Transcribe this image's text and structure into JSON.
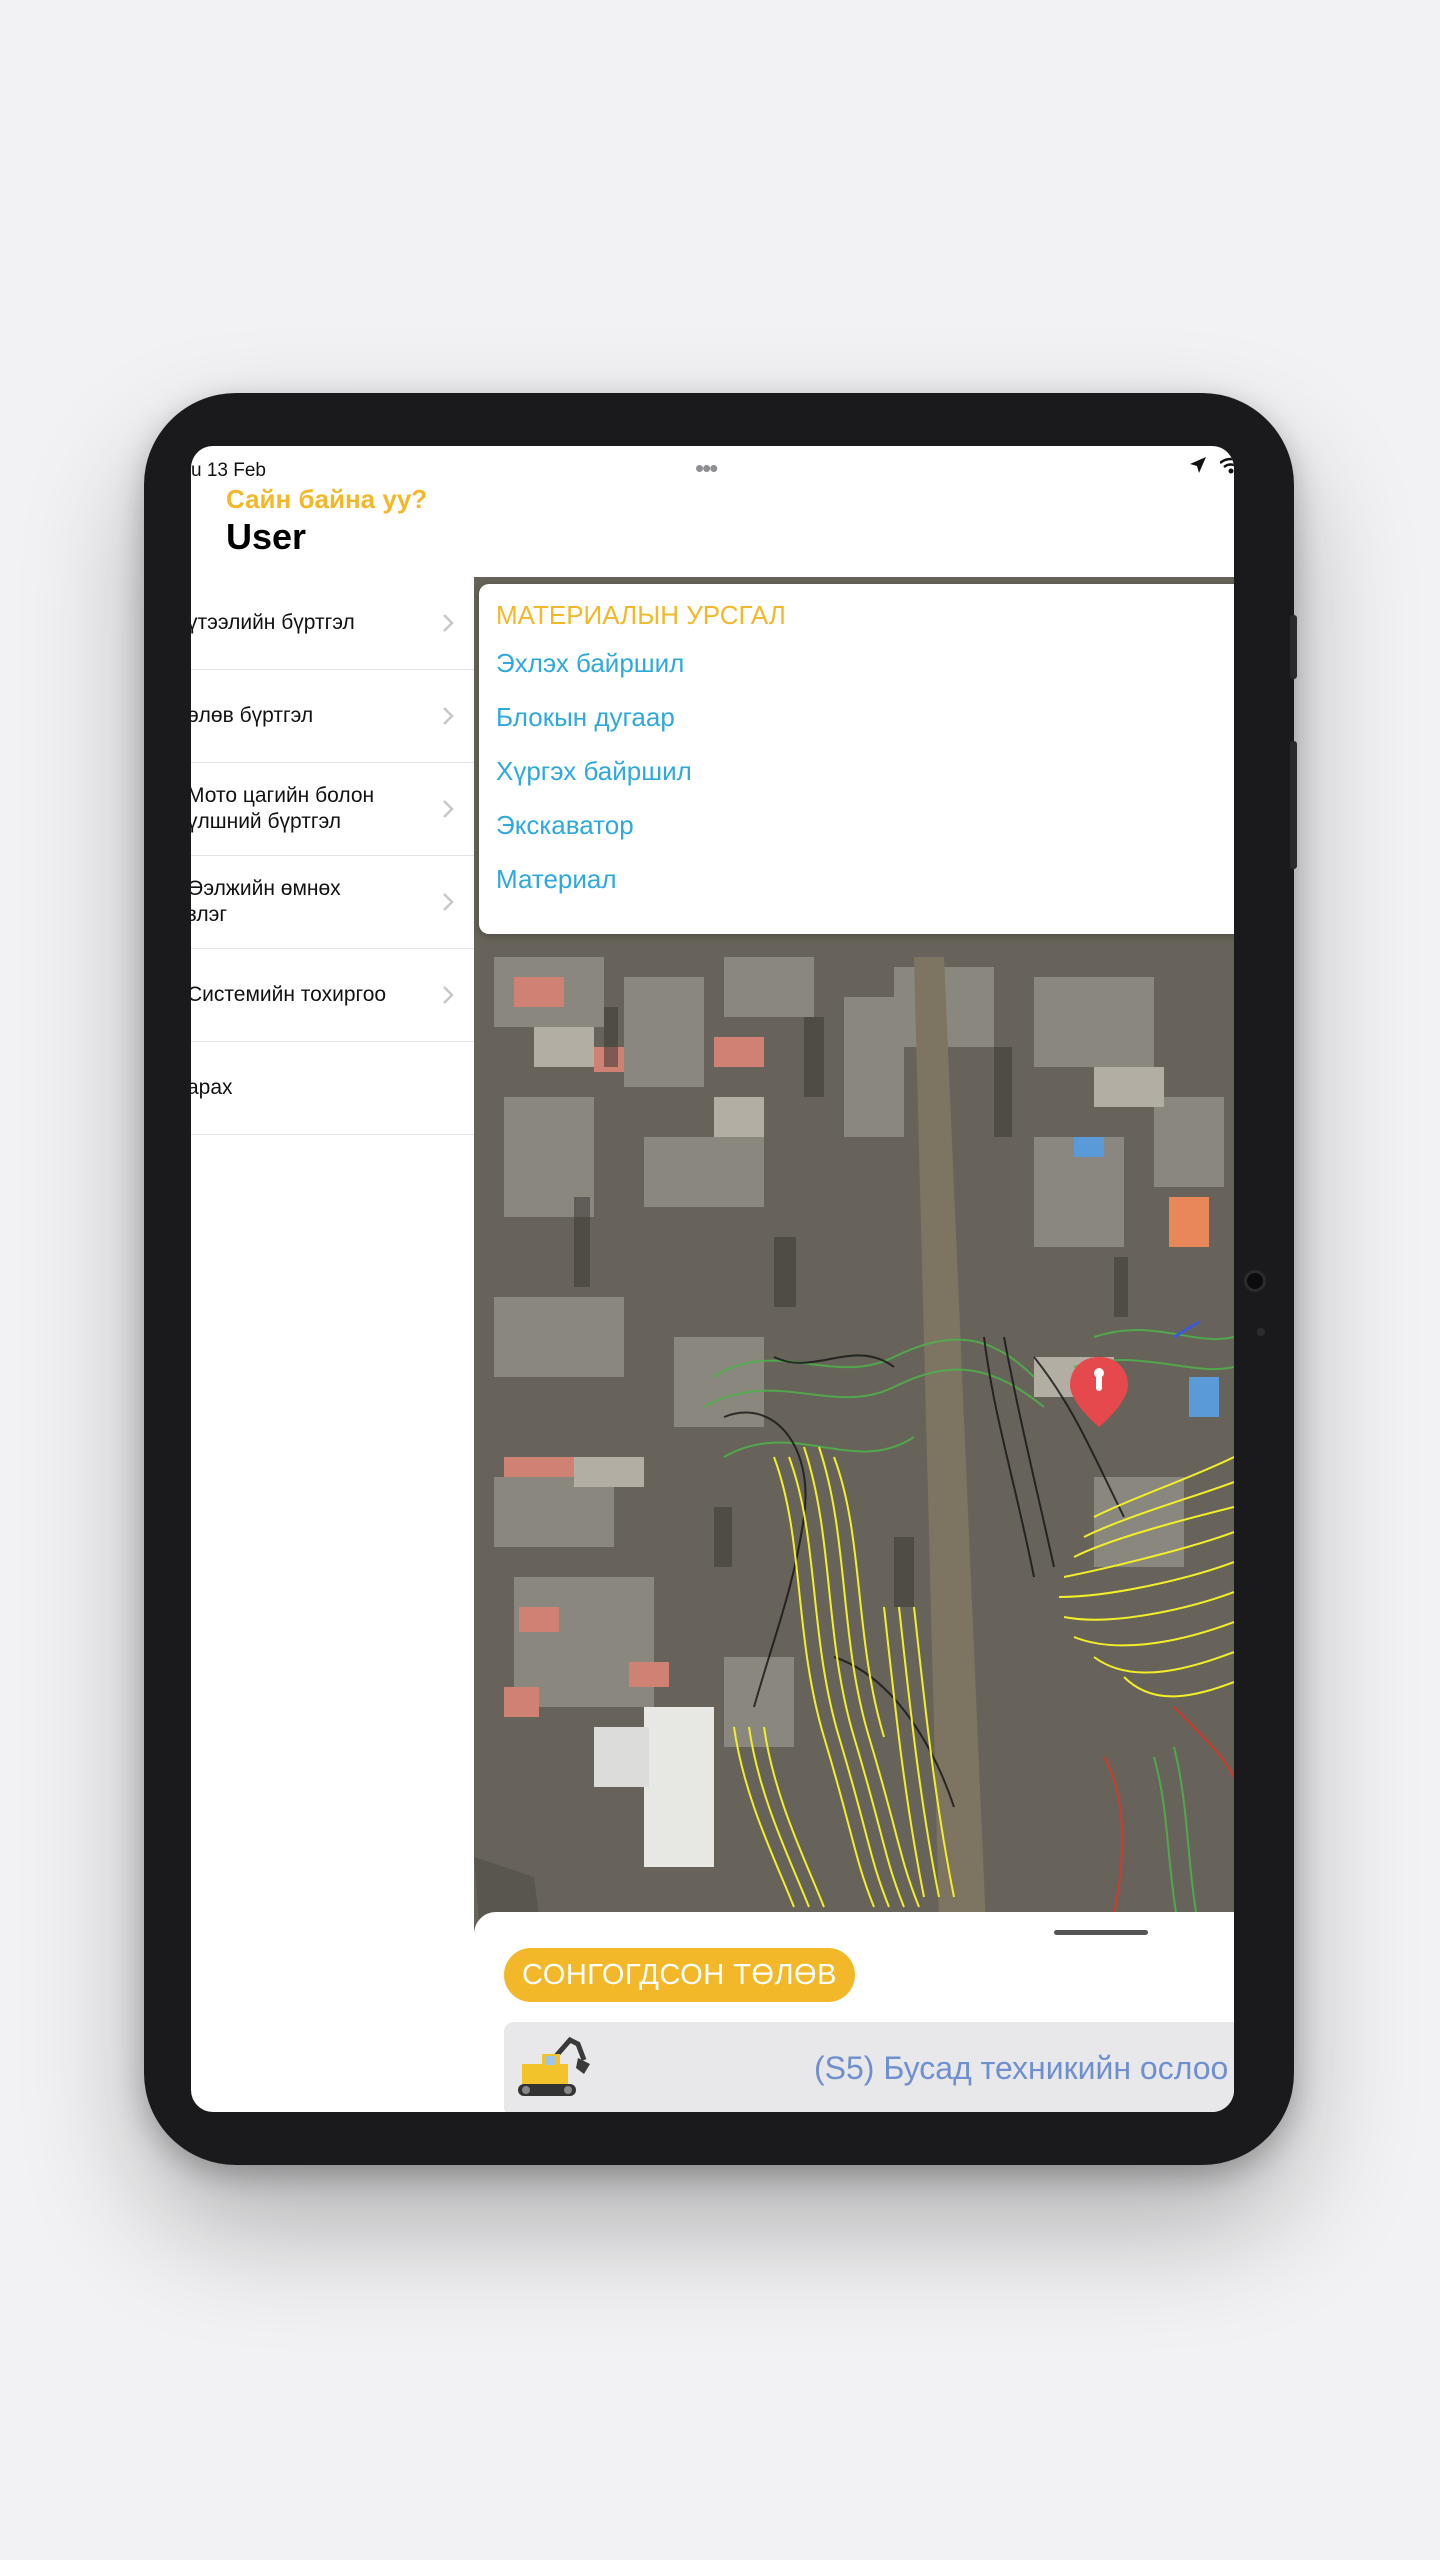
{
  "status_bar": {
    "date": "u 13 Feb",
    "dots": "•••",
    "icons": [
      "location-arrow-icon",
      "wifi-icon"
    ]
  },
  "header": {
    "greeting": "Сайн байна уу?",
    "username": "User"
  },
  "sidebar": {
    "items": [
      {
        "label": "үтээлийн бүртгэл"
      },
      {
        "label": "өлөв бүртгэл"
      },
      {
        "label": "Мото цагийн болон\nүлшний бүртгэл"
      },
      {
        "label": "Өэлжийн өмнөх\nзлэг"
      },
      {
        "label": "Системийн тохиргоо"
      },
      {
        "label": "арах"
      }
    ]
  },
  "popup": {
    "title": "МАТЕРИАЛЫН УРСГАЛ",
    "items": [
      "Эхлэх байршил",
      "Блокын дугаар",
      "Хүргэх байршил",
      "Экскаватор",
      "Материал"
    ]
  },
  "sheet": {
    "chip_label": "СОНГОГДСОН ТӨЛӨВ",
    "selected_text": "(S5) Бусад техникийн ослоо",
    "selected_icon": "excavator-icon"
  },
  "colors": {
    "accent_yellow": "#f3b829",
    "link_blue": "#2fa9dd",
    "status_blue": "#6f8fce",
    "pin_red": "#e5484d"
  }
}
